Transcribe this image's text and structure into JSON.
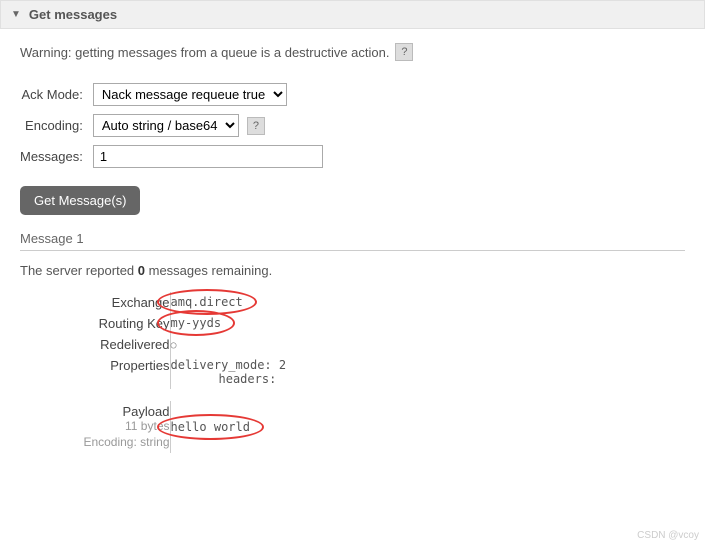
{
  "section": {
    "title": "Get messages"
  },
  "warning": {
    "text": "Warning: getting messages from a queue is a destructive action.",
    "help": "?"
  },
  "form": {
    "ack_label": "Ack Mode:",
    "ack_value": "Nack message requeue true",
    "encoding_label": "Encoding:",
    "encoding_value": "Auto string / base64",
    "encoding_help": "?",
    "messages_label": "Messages:",
    "messages_value": "1",
    "submit": "Get Message(s)"
  },
  "result": {
    "header": "Message 1",
    "remaining_prefix": "The server reported ",
    "remaining_count": "0",
    "remaining_suffix": " messages remaining.",
    "rows": {
      "exchange_label": "Exchange",
      "exchange_value": "amq.direct",
      "routing_label": "Routing Key",
      "routing_value": "my-yyds",
      "redelivered_label": "Redelivered",
      "redelivered_value": "○",
      "properties_label": "Properties",
      "delivery_mode_label": "delivery_mode:",
      "delivery_mode_value": "2",
      "headers_label": "headers:",
      "payload_label": "Payload",
      "payload_size": "11 bytes",
      "payload_encoding": "Encoding: string",
      "payload_value": "hello world"
    }
  },
  "watermark": "CSDN @vcoy"
}
